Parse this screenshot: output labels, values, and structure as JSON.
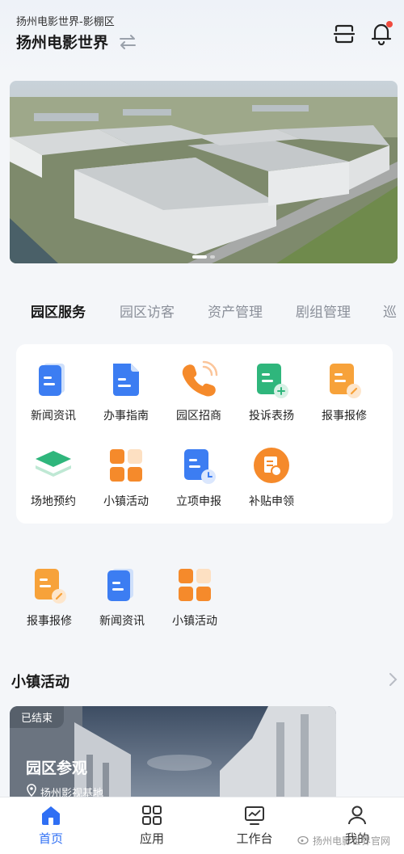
{
  "header": {
    "subtitle": "扬州电影世界-影棚区",
    "title": "扬州电影世界"
  },
  "icons": {
    "swap": "swap-icon",
    "scan": "scan-icon",
    "bell": "bell-icon"
  },
  "tabs": [
    {
      "label": "园区服务",
      "active": true
    },
    {
      "label": "园区访客",
      "active": false
    },
    {
      "label": "资产管理",
      "active": false
    },
    {
      "label": "剧组管理",
      "active": false
    },
    {
      "label": "巡",
      "active": false
    }
  ],
  "services": [
    {
      "label": "新闻资讯",
      "icon": "news-icon"
    },
    {
      "label": "办事指南",
      "icon": "guide-icon"
    },
    {
      "label": "园区招商",
      "icon": "phone-icon"
    },
    {
      "label": "投诉表扬",
      "icon": "complaint-icon"
    },
    {
      "label": "报事报修",
      "icon": "repair-icon"
    },
    {
      "label": "场地预约",
      "icon": "venue-icon"
    },
    {
      "label": "小镇活动",
      "icon": "activity-icon"
    },
    {
      "label": "立项申报",
      "icon": "project-icon"
    },
    {
      "label": "补贴申领",
      "icon": "subsidy-icon"
    }
  ],
  "quick": [
    {
      "label": "报事报修",
      "icon": "repair-icon"
    },
    {
      "label": "新闻资讯",
      "icon": "news-icon"
    },
    {
      "label": "小镇活动",
      "icon": "activity-icon"
    }
  ],
  "section": {
    "title": "小镇活动"
  },
  "activity": {
    "status": "已结束",
    "name": "园区参观",
    "location": "扬州影视基地"
  },
  "nav": [
    {
      "label": "首页",
      "active": true,
      "icon": "home-icon"
    },
    {
      "label": "应用",
      "active": false,
      "icon": "apps-icon"
    },
    {
      "label": "工作台",
      "active": false,
      "icon": "workbench-icon"
    },
    {
      "label": "我的",
      "active": false,
      "icon": "user-icon"
    }
  ],
  "watermark": "扬州电影世界官网",
  "colors": {
    "accent": "#2f6ff4",
    "blue": "#3c7df2",
    "orange": "#f58a2b",
    "green": "#2fb67c",
    "badge": "#f04b3e"
  }
}
